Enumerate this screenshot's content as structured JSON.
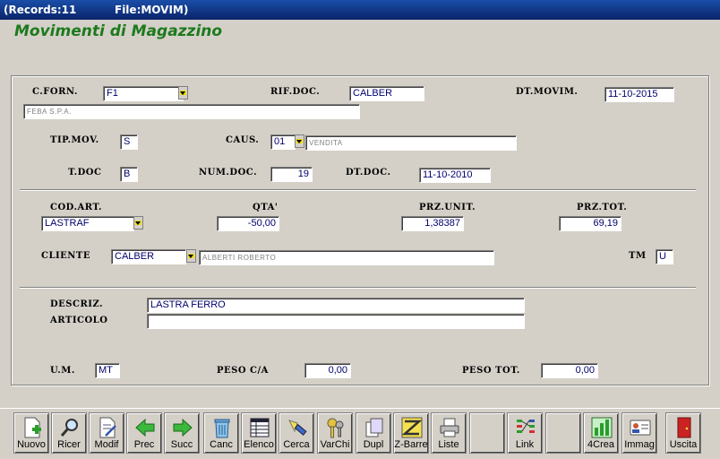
{
  "titlebar": {
    "records": "(Records:11",
    "file": "File:MOVIM)"
  },
  "app_title": "Movimenti di Magazzino",
  "header": {
    "c_forn_label": "C.FORN.",
    "c_forn_value": "F1",
    "c_forn_desc": "FEBA S.P.A.",
    "rif_doc_label": "RIF.DOC.",
    "rif_doc_value": "CALBER",
    "dt_movim_label": "DT.MOVIM.",
    "dt_movim_value": "11-10-2015",
    "tip_mov_label": "TIP.MOV.",
    "tip_mov_value": "S",
    "caus_label": "CAUS.",
    "caus_value": "01",
    "caus_desc": "VENDITA",
    "t_doc_label": "T.DOC",
    "t_doc_value": "B",
    "num_doc_label": "NUM.DOC.",
    "num_doc_value": "19",
    "dt_doc_label": "DT.DOC.",
    "dt_doc_value": "11-10-2010"
  },
  "item": {
    "cod_art_label": "COD.ART.",
    "cod_art_value": "LASTRAF",
    "qta_label": "QTA'",
    "qta_value": "-50,00",
    "prz_unit_label": "PRZ.UNIT.",
    "prz_unit_value": "1,38387",
    "prz_tot_label": "PRZ.TOT.",
    "prz_tot_value": "69,19",
    "cliente_label": "CLIENTE",
    "cliente_value": "CALBER",
    "cliente_desc": "ALBERTI ROBERTO",
    "tm_label": "TM",
    "tm_value": "U"
  },
  "description": {
    "descriz_label": "DESCRIZ.",
    "articolo_label": "ARTICOLO",
    "line1": "LASTRA FERRO",
    "line2": ""
  },
  "footer": {
    "um_label": "U.M.",
    "um_value": "MT",
    "peso_ca_label": "PESO C/A",
    "peso_ca_value": "0,00",
    "peso_tot_label": "PESO TOT.",
    "peso_tot_value": "0,00"
  },
  "toolbar": {
    "nuovo": "Nuovo",
    "ricer": "Ricer",
    "modif": "Modif",
    "prec": "Prec",
    "succ": "Succ",
    "canc": "Canc",
    "elenco": "Elenco",
    "cerca": "Cerca",
    "varchi": "VarChi",
    "dupl": "Dupl",
    "zbarre": "Z-Barre",
    "liste": "Liste",
    "link": "Link",
    "crea4": "4Crea",
    "immag": "Immag",
    "uscita": "Uscita"
  }
}
